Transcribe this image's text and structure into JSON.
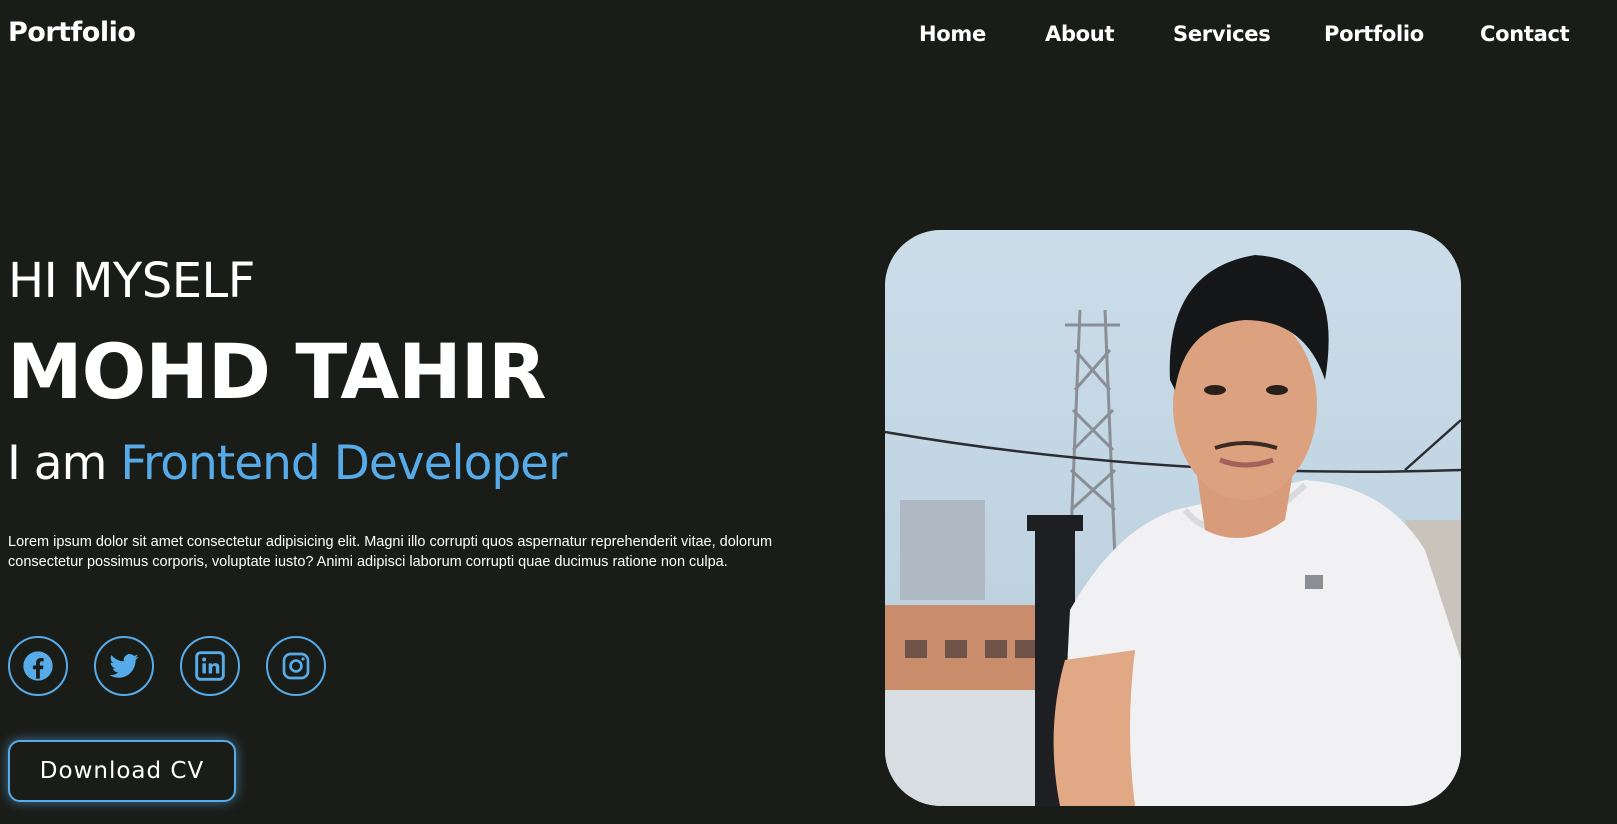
{
  "header": {
    "logo": "Portfolio",
    "nav": [
      {
        "label": "Home"
      },
      {
        "label": "About"
      },
      {
        "label": "Services"
      },
      {
        "label": "Portfolio"
      },
      {
        "label": "Contact"
      }
    ]
  },
  "hero": {
    "greeting": "HI MYSELF",
    "name": "MOHD TAHIR",
    "role_prefix": "I am",
    "role_highlight": "Frontend Developer",
    "description": "Lorem ipsum dolor sit amet consectetur adipisicing elit. Magni illo corrupti quos aspernatur reprehenderit vitae, dolorum consectetur possimus corporis, voluptate iusto? Animi adipisci laborum corrupti quae ducimus ratione non culpa.",
    "socials": [
      {
        "icon": "facebook-icon"
      },
      {
        "icon": "twitter-icon"
      },
      {
        "icon": "linkedin-icon"
      },
      {
        "icon": "instagram-icon"
      }
    ],
    "cv_button": "Download CV",
    "photo": {
      "alt": "Portrait photo"
    }
  },
  "colors": {
    "background": "#1a1c17",
    "accent": "#56abe8",
    "text": "#ffffff"
  }
}
